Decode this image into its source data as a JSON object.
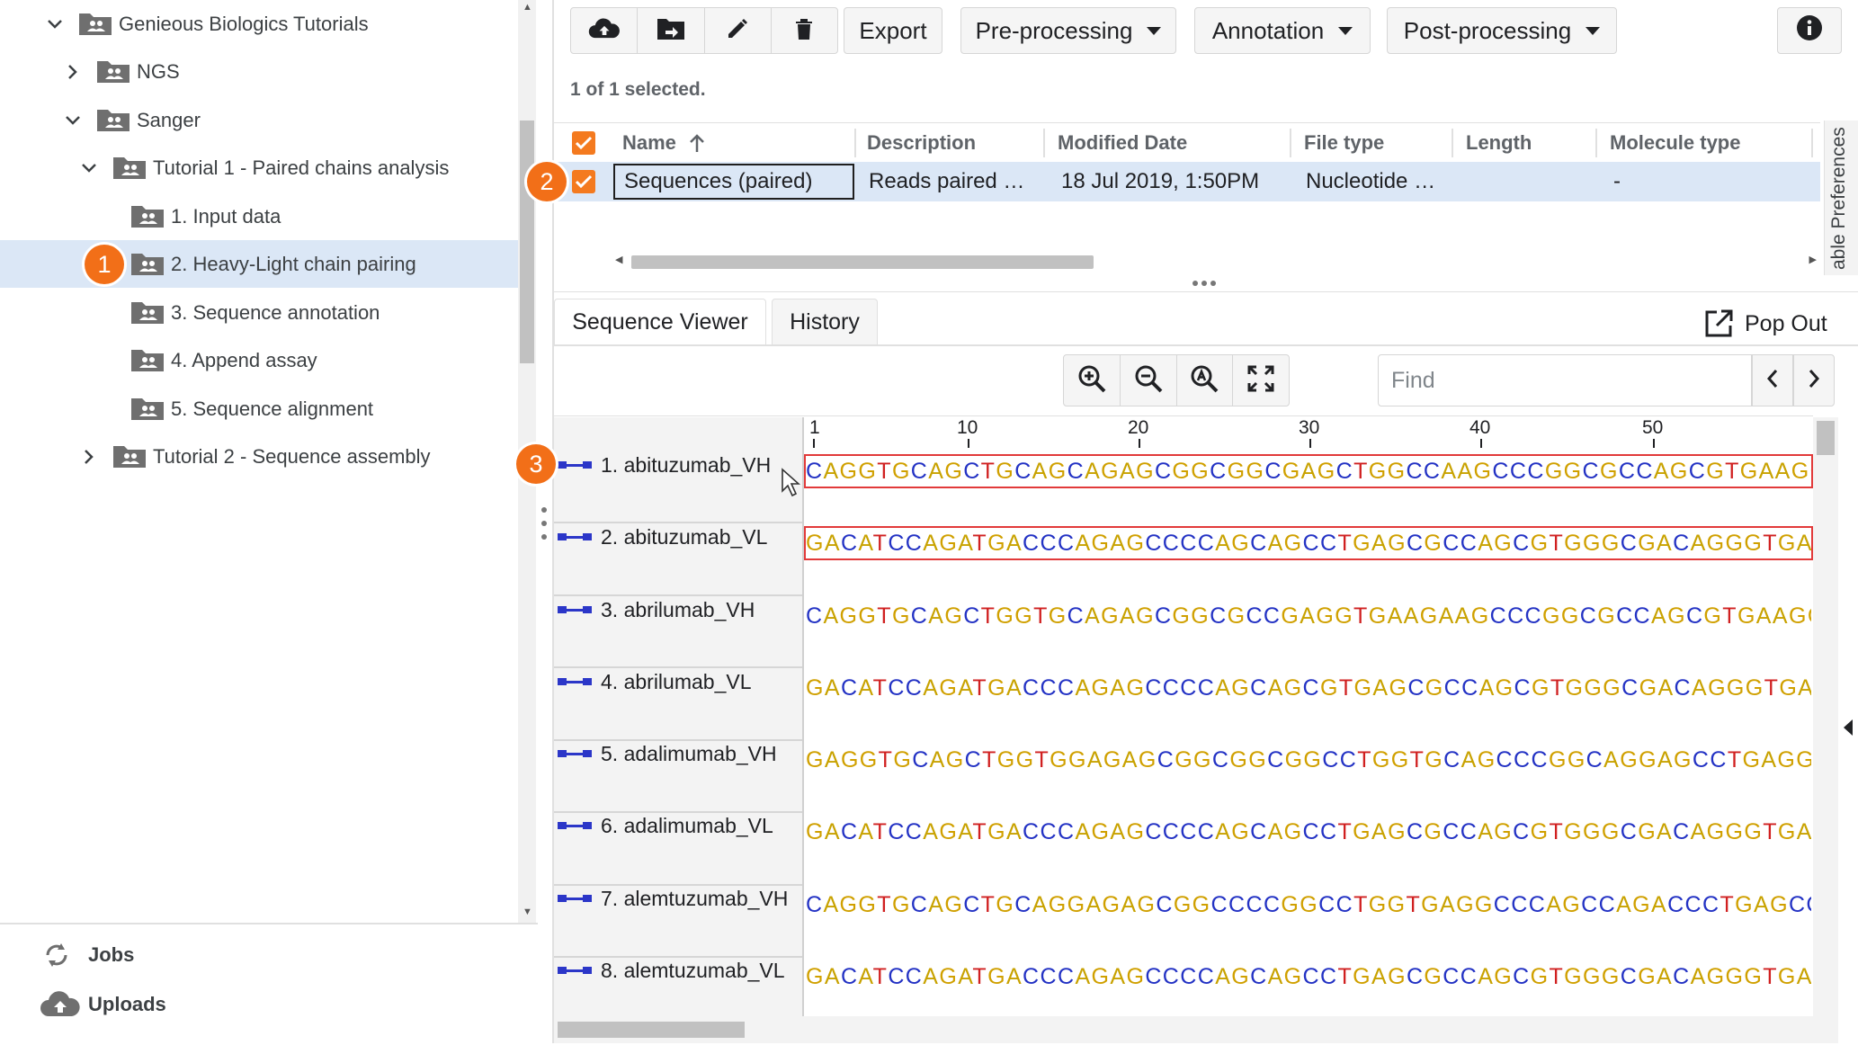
{
  "tree": {
    "root": "Genieous Biologics Tutorials",
    "items": [
      {
        "label": "NGS"
      },
      {
        "label": "Sanger"
      },
      {
        "label": "Tutorial 1 - Paired chains analysis"
      },
      {
        "label": "1. Input data"
      },
      {
        "label": "2. Heavy-Light chain pairing"
      },
      {
        "label": "3. Sequence annotation"
      },
      {
        "label": "4. Append assay"
      },
      {
        "label": "5. Sequence alignment"
      },
      {
        "label": "Tutorial 2 - Sequence assembly"
      }
    ]
  },
  "bottom_panel": {
    "jobs": "Jobs",
    "uploads": "Uploads"
  },
  "toolbar": {
    "export": "Export",
    "preprocessing": "Pre-processing",
    "annotation": "Annotation",
    "postprocessing": "Post-processing"
  },
  "selection": {
    "count_text": "1 of 1 selected."
  },
  "table": {
    "headers": [
      "Name",
      "Description",
      "Modified Date",
      "File type",
      "Length",
      "Molecule type"
    ],
    "row": [
      "Sequences (paired)",
      "Reads paired …",
      "18 Jul 2019, 1:50PM",
      "Nucleotide …",
      "",
      "-"
    ],
    "preferences_tab": "able Preferences"
  },
  "viewer": {
    "tabs": [
      "Sequence Viewer",
      "History"
    ],
    "popout": "Pop Out",
    "find_placeholder": "Find",
    "ruler": [
      "1",
      "10",
      "20",
      "30",
      "40",
      "50"
    ],
    "sequences": [
      {
        "name": "1. abituzumab_VH",
        "seq": "CAGGTGCAGCTGCAGCAGAGCGGCGGCGAGCTGGCCAAGCCCGGCGCCAGCGTGAAGGT"
      },
      {
        "name": "2. abituzumab_VL",
        "seq": "GACATCCAGATGACCCAGAGCCCCAGCAGCCTGAGCGCCAGCGTGGGCGACAGGGTGAC"
      },
      {
        "name": "3. abrilumab_VH",
        "seq": "CAGGTGCAGCTGGTGCAGAGCGGCGCCGAGGTGAAGAAGCCCGGCGCCAGCGTGAAGGT"
      },
      {
        "name": "4. abrilumab_VL",
        "seq": "GACATCCAGATGACCCAGAGCCCCAGCAGCGTGAGCGCCAGCGTGGGCGACAGGGTGAC"
      },
      {
        "name": "5. adalimumab_VH",
        "seq": "GAGGTGCAGCTGGTGGAGAGCGGCGGCGGCCTGGTGCAGCCCGGCAGGAGCCTGAGGCT"
      },
      {
        "name": "6. adalimumab_VL",
        "seq": "GACATCCAGATGACCCAGAGCCCCAGCAGCCTGAGCGCCAGCGTGGGCGACAGGGTGAC"
      },
      {
        "name": "7. alemtuzumab_VH",
        "seq": "CAGGTGCAGCTGCAGGAGAGCGGCCCCGGCCTGGTGAGGCCCAGCCAGACCCTGAGCCT"
      },
      {
        "name": "8. alemtuzumab_VL",
        "seq": "GACATCCAGATGACCCAGAGCCCCAGCAGCCTGAGCGCCAGCGTGGGCGACAGGGTGAC"
      }
    ]
  },
  "markers": [
    "1",
    "2",
    "3"
  ],
  "colors": {
    "accent": "#f26f18",
    "selection": "#dbe7f6",
    "base_A": "#c8a200",
    "base_C": "#2332c4",
    "base_G": "#d0a000",
    "base_T": "#d02020"
  }
}
